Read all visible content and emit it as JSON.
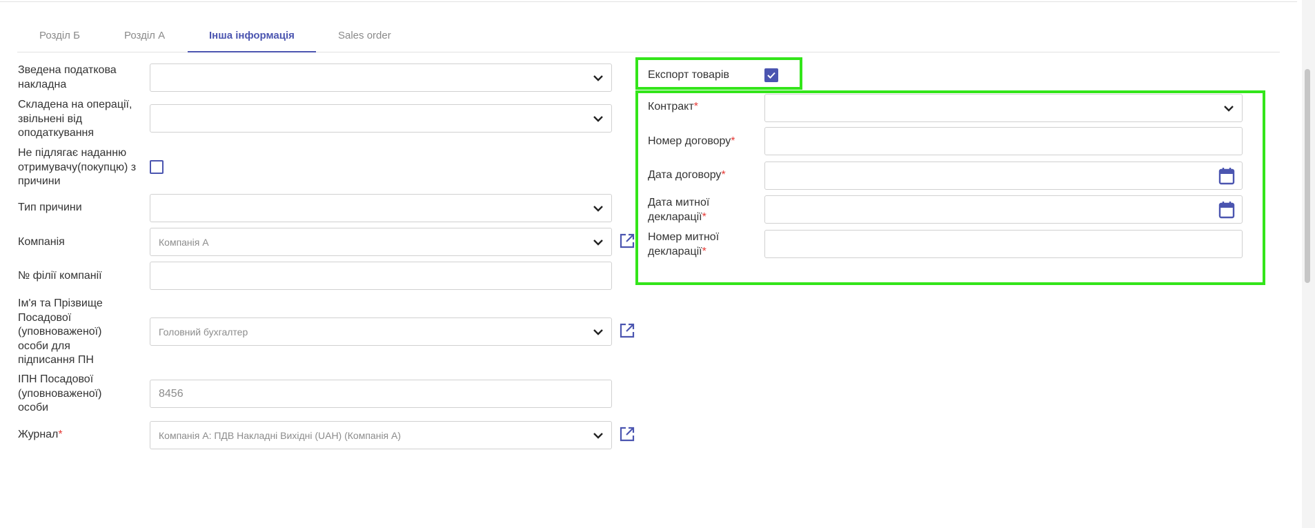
{
  "tabs": [
    {
      "label": "Розділ Б"
    },
    {
      "label": "Розділ А"
    },
    {
      "label": "Інша інформація"
    },
    {
      "label": "Sales order"
    }
  ],
  "left_form": {
    "consolidated_invoice": {
      "label": "Зведена податкова накладна",
      "value": ""
    },
    "exempt_operations": {
      "label": "Складена на операції, звільнені від оподаткування",
      "value": ""
    },
    "not_given_to_buyer": {
      "label": "Не підлягає наданню отримувачу(покупцю) з причини",
      "checked": false
    },
    "reason_type": {
      "label": "Тип причини",
      "value": ""
    },
    "company": {
      "label": "Компанія",
      "value": "Компанія А"
    },
    "branch_no": {
      "label": "№ філії компанії",
      "value": ""
    },
    "signatory": {
      "label": "Ім'я та Прізвище Посадової (уповноваженої) особи для підписання ПН",
      "value": "Головний бухгалтер"
    },
    "signatory_ipn": {
      "label": "ІПН Посадової (уповноваженої) особи",
      "value": "8456"
    },
    "journal": {
      "label": "Журнал",
      "required_mark": "*",
      "value": "Компанія А: ПДВ Накладні Вихідні (UAH) (Компанія А)"
    }
  },
  "right_form": {
    "export_goods": {
      "label": "Експорт товарів",
      "checked": true
    },
    "contract": {
      "label": "Контракт",
      "required_mark": "*",
      "value": ""
    },
    "contract_number": {
      "label": "Номер договору",
      "required_mark": "*",
      "value": ""
    },
    "contract_date": {
      "label": "Дата договору",
      "required_mark": "*",
      "value": ""
    },
    "customs_date": {
      "label": "Дата митної декларації",
      "required_mark": "*",
      "value": ""
    },
    "customs_number": {
      "label": "Номер митної декларації",
      "required_mark": "*",
      "value": ""
    }
  },
  "colors": {
    "accent": "#4b55b0",
    "highlight": "#33e51a",
    "required": "#e53935"
  },
  "icons": {
    "dropdown": "chevron-down-icon",
    "calendar": "calendar-icon",
    "external_link": "external-link-icon",
    "checkmark": "checkmark-icon"
  }
}
